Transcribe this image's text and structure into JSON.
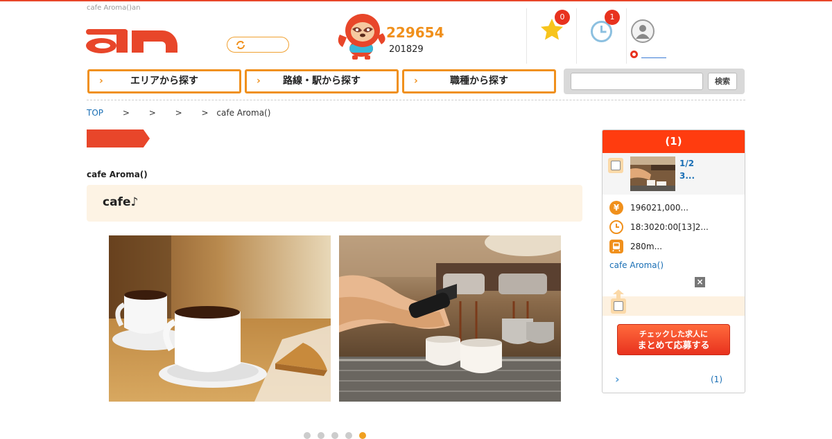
{
  "header": {
    "site_caption": "cafe Aroma()an",
    "logo_text": "an",
    "counts": {
      "main": "229654",
      "sub": "201829"
    },
    "favorites_badge": "0",
    "history_badge": "1",
    "colors": {
      "accent": "#e8462a",
      "orange": "#f0901c"
    }
  },
  "nav": {
    "area_label": "エリアから探す",
    "route_label": "路線・駅から探す",
    "job_label": "職種から探す",
    "search_placeholder": "",
    "search_button": "検索"
  },
  "breadcrumb": {
    "top": "TOP",
    "sep1": ">",
    "sep2": ">",
    "sep3": ">",
    "sep4": ">",
    "current": "cafe Aroma()"
  },
  "main": {
    "shop_name": "cafe Aroma()",
    "catch_copy": "cafe♪",
    "slideshow": {
      "dot_count": 5,
      "active_index": 4
    }
  },
  "sidebar": {
    "header": "(1)",
    "job_title_line1": "1/2",
    "job_title_line2": "3...",
    "salary": "196021,000...",
    "hours": "18:3020:00[13]2...",
    "access": "280m...",
    "shop_link": "cafe Aroma()",
    "close_symbol": "×",
    "apply_line1": "チェックした求人に",
    "apply_line2": "まとめて応募する",
    "footer_count": "(1)",
    "icons": {
      "salary": "yen-icon",
      "hours": "clock-icon",
      "access": "train-icon"
    }
  }
}
